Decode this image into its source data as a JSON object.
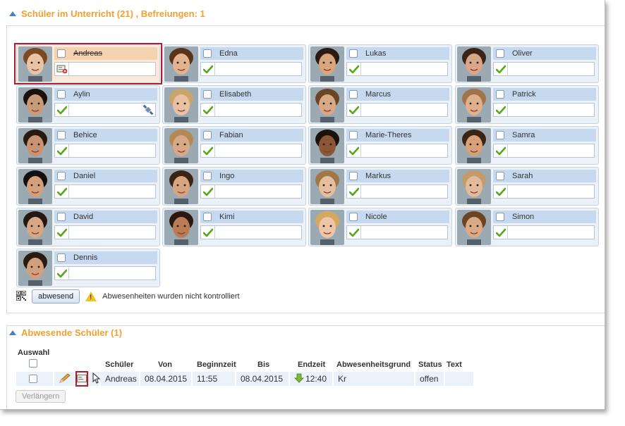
{
  "present_section": {
    "title": "Schüler im Unterricht (21) , Befreiungen: 1"
  },
  "students": [
    {
      "name": "Andreas",
      "status": "excused",
      "selected": true,
      "struck": true,
      "skin": "#e9c4a4",
      "hair": "#7a4a22"
    },
    {
      "name": "Edna",
      "status": "present",
      "skin": "#e2b38e",
      "hair": "#5a3418"
    },
    {
      "name": "Lukas",
      "status": "present",
      "skin": "#d9a57d",
      "hair": "#2a1a10"
    },
    {
      "name": "Oliver",
      "status": "present",
      "skin": "#d8a688",
      "hair": "#3a2418"
    },
    {
      "name": "Aylin",
      "status": "present",
      "note_icon": "satellite-icon",
      "skin": "#c99a78",
      "hair": "#1a1208"
    },
    {
      "name": "Elisabeth",
      "status": "present",
      "skin": "#e7c1a2",
      "hair": "#caa56a"
    },
    {
      "name": "Marcus",
      "status": "present",
      "skin": "#d9a884",
      "hair": "#6b4626"
    },
    {
      "name": "Patrick",
      "status": "present",
      "skin": "#e0b08e",
      "hair": "#a0744a"
    },
    {
      "name": "Behice",
      "status": "present",
      "skin": "#c89370",
      "hair": "#2a1a0e"
    },
    {
      "name": "Fabian",
      "status": "present",
      "skin": "#d7a988",
      "hair": "#b58954"
    },
    {
      "name": "Marie-Theres",
      "status": "present",
      "skin": "#8a5838",
      "hair": "#1c120a"
    },
    {
      "name": "Samra",
      "status": "present",
      "skin": "#d6a07a",
      "hair": "#3c2414"
    },
    {
      "name": "Daniel",
      "status": "present",
      "skin": "#d2a07c",
      "hair": "#141010"
    },
    {
      "name": "Ingo",
      "status": "present",
      "skin": "#d7a582",
      "hair": "#3a2414"
    },
    {
      "name": "Markus",
      "status": "present",
      "skin": "#e4be9e",
      "hair": "#a07848"
    },
    {
      "name": "Sarah",
      "status": "present",
      "skin": "#e3bb9c",
      "hair": "#c49c6a"
    },
    {
      "name": "David",
      "status": "present",
      "skin": "#d7a684",
      "hair": "#241812"
    },
    {
      "name": "Kimi",
      "status": "present",
      "skin": "#b97c56",
      "hair": "#2a180e"
    },
    {
      "name": "Nicole",
      "status": "present",
      "skin": "#ecc6a6",
      "hair": "#d4a860"
    },
    {
      "name": "Simon",
      "status": "present",
      "skin": "#d8aa88",
      "hair": "#6a4424"
    },
    {
      "name": "Dennis",
      "status": "present",
      "skin": "#d2a07c",
      "hair": "#2a1a10"
    }
  ],
  "controls": {
    "absent_button": "abwesend",
    "warning_text": "Abwesenheiten wurden nicht kontrolliert"
  },
  "absent_section": {
    "title": "Abwesende Schüler (1)",
    "select_label": "Auswahl",
    "columns": [
      "Schüler",
      "Von",
      "Beginnzeit",
      "Bis",
      "Endzeit",
      "Abwesenheitsgrund",
      "Status",
      "Text"
    ],
    "rows": [
      {
        "student": "Andreas",
        "from": "08.04.2015",
        "start": "11:55",
        "to": "08.04.2015",
        "end": "12:40",
        "reason": "Kr",
        "status": "offen",
        "text": ""
      }
    ],
    "extend_button": "Verlängern"
  },
  "colors": {
    "accent": "#f0a030",
    "selection": "#b01c2e",
    "check": "#5aa51a"
  }
}
